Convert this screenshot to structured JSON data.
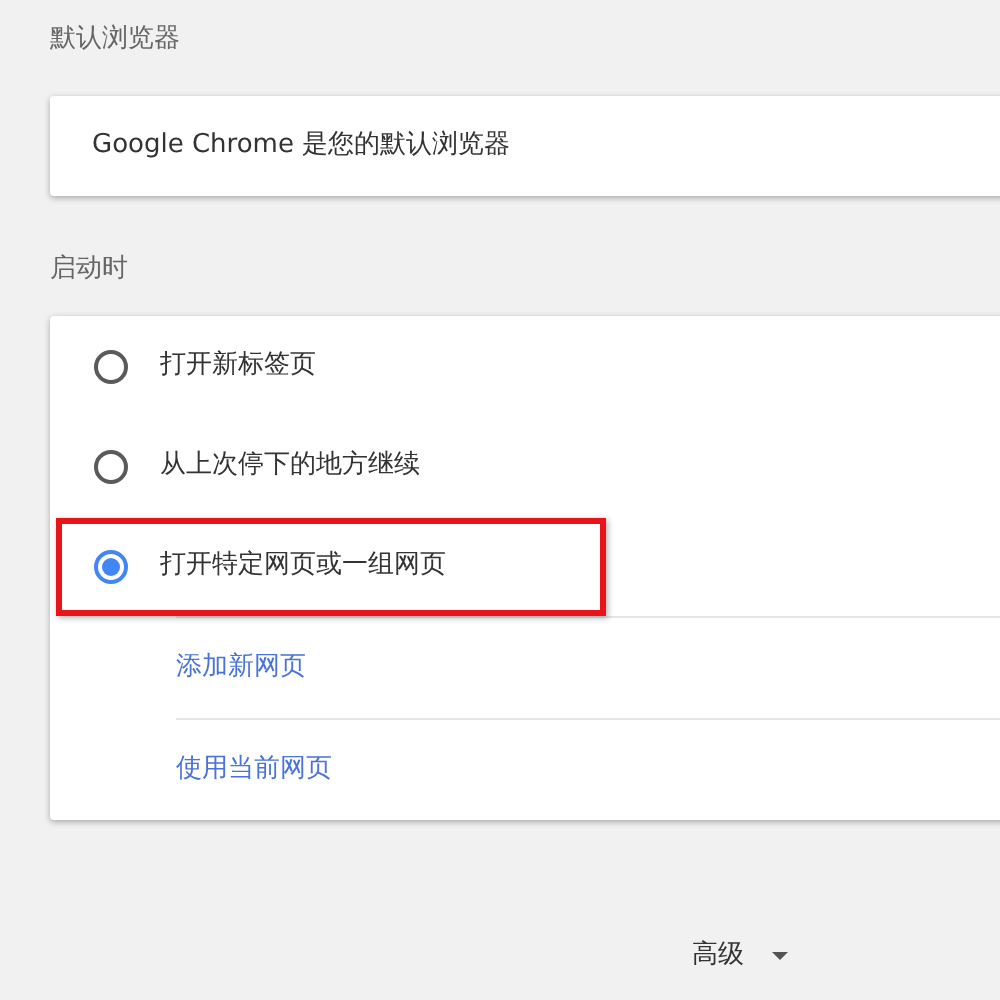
{
  "default_browser": {
    "heading": "默认浏览器",
    "status": "Google Chrome 是您的默认浏览器"
  },
  "startup": {
    "heading": "启动时",
    "options": [
      {
        "label": "打开新标签页",
        "selected": false,
        "highlighted": false
      },
      {
        "label": "从上次停下的地方继续",
        "selected": false,
        "highlighted": false
      },
      {
        "label": "打开特定网页或一组网页",
        "selected": true,
        "highlighted": true
      }
    ],
    "links": [
      "添加新网页",
      "使用当前网页"
    ]
  },
  "advanced": {
    "label": "高级"
  }
}
